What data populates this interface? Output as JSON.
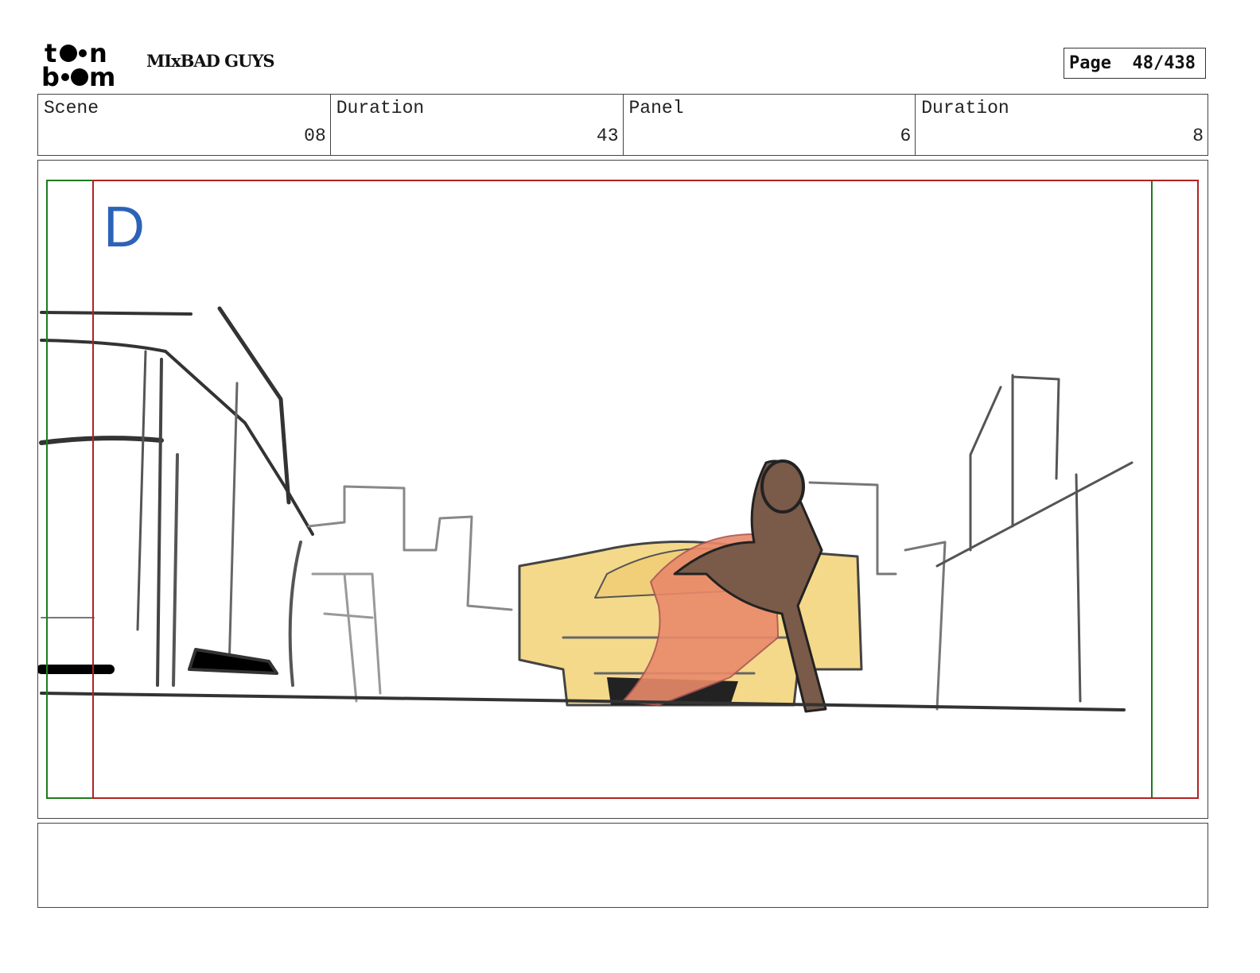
{
  "header": {
    "logo_text": "toon boom",
    "project_title": "MIxBAD GUYS",
    "page_label": "Page",
    "page_value": "48/438"
  },
  "info": [
    {
      "label": "Scene",
      "value": "08"
    },
    {
      "label": "Duration",
      "value": "43"
    },
    {
      "label": "Panel",
      "value": "6"
    },
    {
      "label": "Duration",
      "value": "8"
    }
  ],
  "panel": {
    "letter": "D",
    "colors": {
      "safe_frame": "#1e7a1e",
      "camera_frame": "#b22222",
      "car": "#f5d98a",
      "figure_dark": "#7a5a48",
      "figure_light": "#e98a6a"
    }
  },
  "notes": {}
}
